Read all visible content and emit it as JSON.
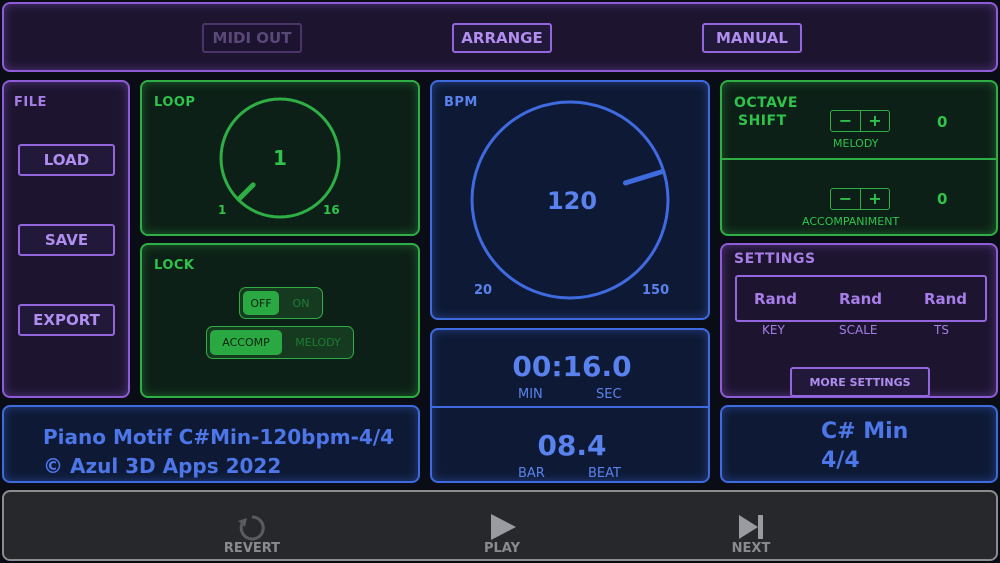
{
  "top_bar": {
    "midi_out": "MIDI OUT",
    "arrange": "ARRANGE",
    "manual": "MANUAL"
  },
  "file": {
    "title": "FILE",
    "load": "LOAD",
    "save": "SAVE",
    "export": "EXPORT"
  },
  "loop": {
    "title": "LOOP",
    "value": "1",
    "min": "1",
    "max": "16",
    "level": 0.0
  },
  "lock": {
    "title": "LOCK",
    "off": "OFF",
    "on": "ON",
    "selected": "OFF",
    "accomp": "ACCOMP",
    "melody": "MELODY",
    "part_selected": "ACCOMP"
  },
  "bpm": {
    "title": "BPM",
    "value": "120",
    "min": "20",
    "max": "150",
    "level": 0.77
  },
  "time": {
    "value": "00:16.0",
    "min_label": "MIN",
    "sec_label": "SEC"
  },
  "position": {
    "value": "08.4",
    "bar_label": "BAR",
    "beat_label": "BEAT"
  },
  "octave": {
    "title_line1": "OCTAVE",
    "title_line2": "SHIFT",
    "minus": "−",
    "plus": "+",
    "melody_label": "MELODY",
    "melody_value": "0",
    "accomp_label": "ACCOMPANIMENT",
    "accomp_value": "0"
  },
  "settings": {
    "title": "SETTINGS",
    "key_value": "Rand",
    "scale_value": "Rand",
    "ts_value": "Rand",
    "key_label": "KEY",
    "scale_label": "SCALE",
    "ts_label": "TS",
    "more": "MORE SETTINGS"
  },
  "info": {
    "line1": "Piano Motif C#Min-120bpm-4/4",
    "line2": "© Azul 3D Apps 2022"
  },
  "key_display": {
    "key": "C# Min",
    "time_sig": "4/4"
  },
  "transport": {
    "revert": "REVERT",
    "play": "PLAY",
    "next": "NEXT"
  },
  "colors": {
    "purple": "#8e5cd6",
    "green": "#2fae45",
    "blue": "#3f6ae0",
    "background": "#0a0c16"
  }
}
